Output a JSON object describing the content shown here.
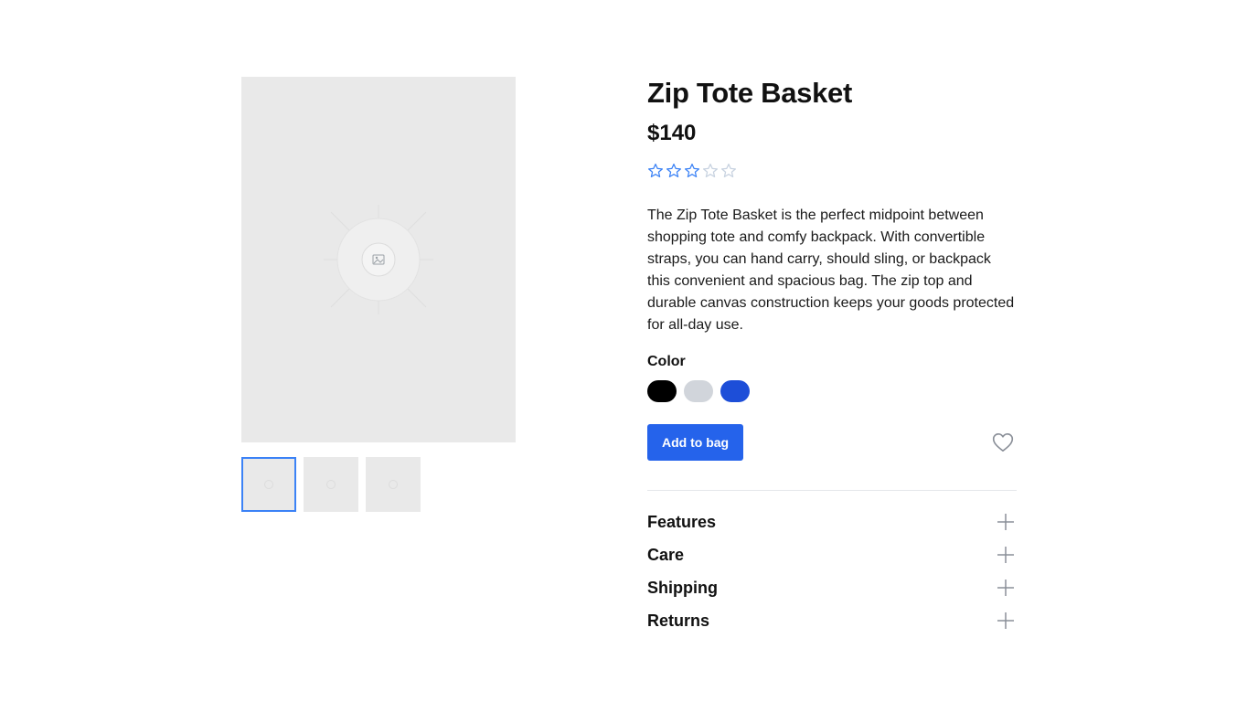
{
  "product": {
    "title": "Zip Tote Basket",
    "price": "$140",
    "rating": 3,
    "rating_max": 5,
    "description": "The Zip Tote Basket is the perfect midpoint between shopping tote and comfy backpack. With convertible straps, you can hand carry, should sling, or backpack this convenient and spacious bag. The zip top and durable canvas construction keeps your goods protected for all-day use."
  },
  "gallery": {
    "main_icon": "image-placeholder-icon",
    "thumbnails": [
      {
        "icon": "image-placeholder-icon",
        "selected": true
      },
      {
        "icon": "image-placeholder-icon",
        "selected": false
      },
      {
        "icon": "image-placeholder-icon",
        "selected": false
      }
    ]
  },
  "color": {
    "label": "Color",
    "options": [
      {
        "name": "black",
        "hex": "#000000"
      },
      {
        "name": "gray",
        "hex": "#d1d5db"
      },
      {
        "name": "blue",
        "hex": "#1d4ed8"
      }
    ]
  },
  "actions": {
    "add_to_bag": "Add to bag",
    "favorite_icon": "heart-icon"
  },
  "accordion": {
    "items": [
      {
        "label": "Features",
        "icon": "plus-icon"
      },
      {
        "label": "Care",
        "icon": "plus-icon"
      },
      {
        "label": "Shipping",
        "icon": "plus-icon"
      },
      {
        "label": "Returns",
        "icon": "plus-icon"
      }
    ]
  },
  "colors": {
    "accent": "#2563eb",
    "star_filled": "#3b82f6",
    "star_empty": "#c7d2e0",
    "placeholder_bg": "#e9e9e9"
  }
}
